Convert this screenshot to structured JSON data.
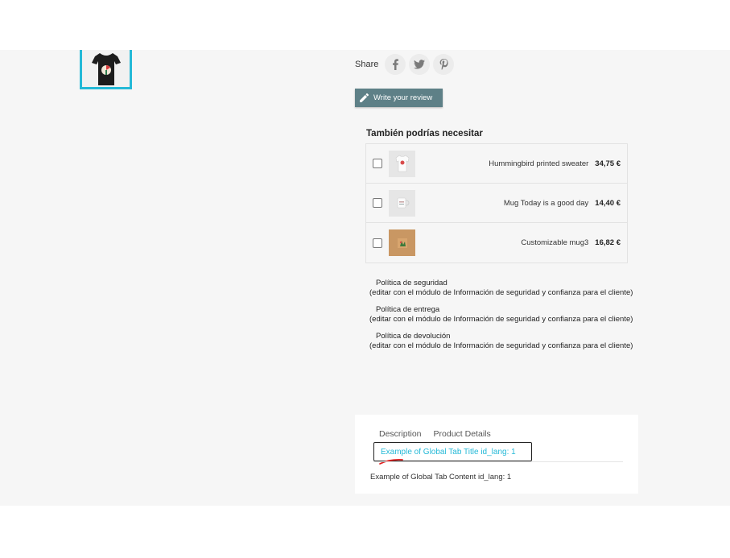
{
  "share": {
    "label": "Share",
    "icons": [
      "facebook-icon",
      "twitter-icon",
      "pinterest-icon"
    ]
  },
  "review": {
    "label": "Write your review"
  },
  "accessories": {
    "title": "También podrías necesitar",
    "items": [
      {
        "name": "Hummingbird printed sweater",
        "price": "34,75 €"
      },
      {
        "name": "Mug Today is a good day",
        "price": "14,40 €"
      },
      {
        "name": "Customizable mug3",
        "price": "16,82 €"
      }
    ]
  },
  "policies": [
    {
      "title": "Política de seguridad",
      "desc": "(editar con el módulo de Información de seguridad y confianza para el cliente)"
    },
    {
      "title": "Política de entrega",
      "desc": "(editar con el módulo de Información de seguridad y confianza para el cliente)"
    },
    {
      "title": "Política de devolución",
      "desc": "(editar con el módulo de Información de seguridad y confianza para el cliente)"
    }
  ],
  "tabs": {
    "items": [
      "Description",
      "Product Details"
    ],
    "global_title": "Example of Global Tab Title id_lang: 1",
    "content": "Example of Global Tab Content id_lang: 1"
  },
  "colors": {
    "accent": "#24b9d7",
    "button": "#5e8087",
    "band": "#f6f6f6"
  }
}
